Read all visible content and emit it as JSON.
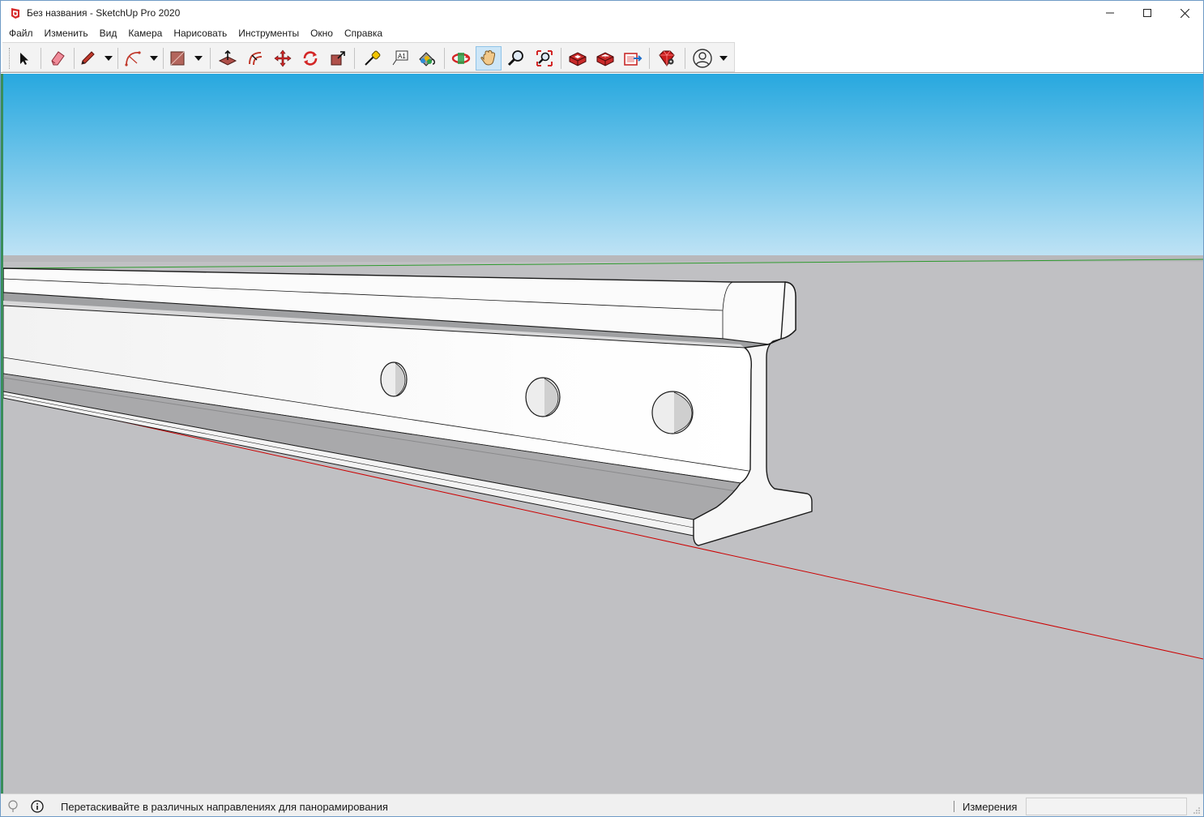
{
  "window": {
    "title": "Без названия - SketchUp Pro 2020",
    "controls": {
      "minimize": "—",
      "maximize": "☐",
      "close": "✕"
    }
  },
  "menu": [
    "Файл",
    "Изменить",
    "Вид",
    "Камера",
    "Нарисовать",
    "Инструменты",
    "Окно",
    "Справка"
  ],
  "toolbar": {
    "tools": [
      {
        "name": "select",
        "icon": "arrow-cursor-icon"
      },
      {
        "name": "eraser",
        "icon": "eraser-icon"
      },
      {
        "name": "line",
        "icon": "pencil-icon"
      },
      {
        "name": "arc",
        "icon": "arc-icon"
      },
      {
        "name": "shape",
        "icon": "rectangle-icon"
      },
      {
        "name": "push-pull",
        "icon": "push-pull-icon"
      },
      {
        "name": "offset",
        "icon": "offset-icon"
      },
      {
        "name": "move",
        "icon": "move-icon"
      },
      {
        "name": "rotate",
        "icon": "rotate-icon"
      },
      {
        "name": "scale",
        "icon": "scale-icon"
      },
      {
        "name": "tape-measure",
        "icon": "tape-measure-icon"
      },
      {
        "name": "text",
        "icon": "text-icon"
      },
      {
        "name": "paint-bucket",
        "icon": "paint-bucket-icon"
      },
      {
        "name": "orbit",
        "icon": "orbit-icon"
      },
      {
        "name": "pan",
        "icon": "hand-icon",
        "active": true
      },
      {
        "name": "zoom",
        "icon": "zoom-icon"
      },
      {
        "name": "zoom-extents",
        "icon": "zoom-extents-icon"
      },
      {
        "name": "warehouse",
        "icon": "warehouse-icon"
      },
      {
        "name": "extension-warehouse",
        "icon": "extension-warehouse-icon"
      },
      {
        "name": "send-to-layout",
        "icon": "layout-icon"
      },
      {
        "name": "extension-manager",
        "icon": "ruby-icon"
      },
      {
        "name": "account",
        "icon": "user-icon"
      }
    ],
    "text_tool_glyph": "A1"
  },
  "status": {
    "hint": "Перетаскивайте в различных направлениях для панорамирования",
    "measure_label": "Измерения",
    "measure_value": ""
  },
  "colors": {
    "sky_top": "#27a8df",
    "sky_bottom": "#bfe3f5",
    "ground": "#c0c0c3",
    "red_axis": "#cc0000",
    "green_axis": "#2e9a2e",
    "rail_face": "#fbfbfb",
    "rail_shadow": "#a9a9ab"
  }
}
